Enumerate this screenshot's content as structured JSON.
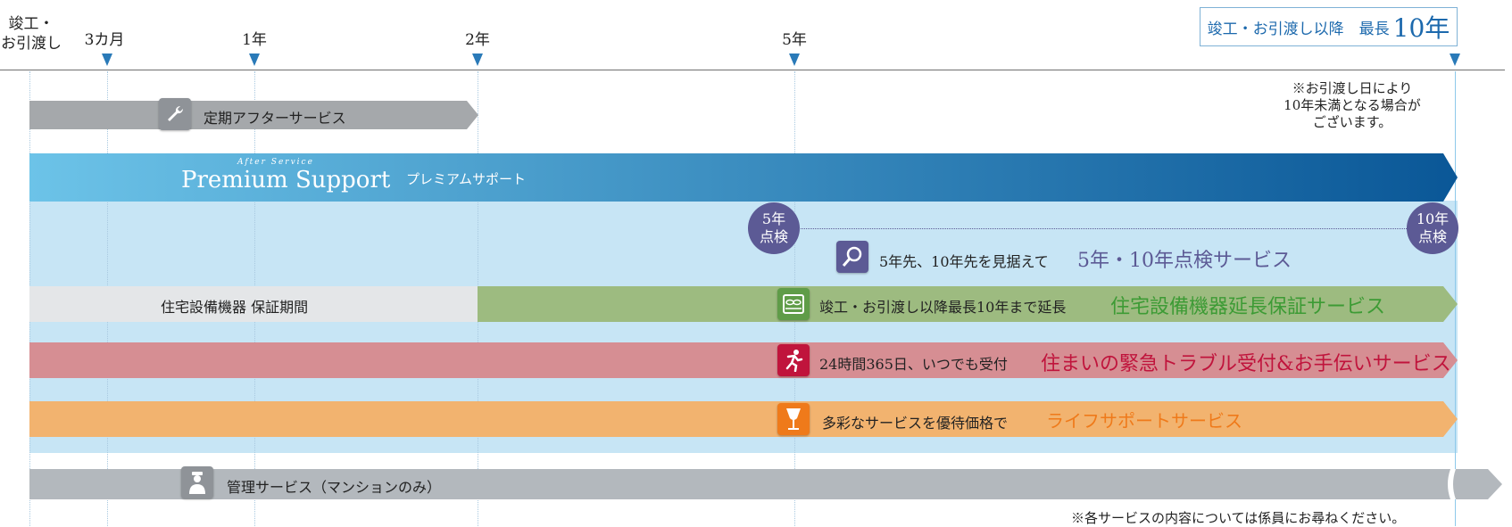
{
  "timeline": {
    "start_label_line1": "竣工・",
    "start_label_line2": "お引渡し",
    "ticks": [
      "3カ月",
      "1年",
      "2年",
      "5年"
    ]
  },
  "max_box": {
    "text": "竣工・お引渡し以降　最長",
    "value": "10年"
  },
  "note_max": [
    "※お引渡し日により",
    "10年未満となる場合が",
    "ございます。"
  ],
  "periodic": {
    "label": "定期アフターサービス",
    "icon": "wrench-icon",
    "color": "#a5a8ab"
  },
  "premium": {
    "small": "After Service",
    "logo": "Premium Support",
    "sub": "プレミアムサポート",
    "color_start": "#6cc3e8",
    "color_end": "#0a5797"
  },
  "inspection": {
    "circle_left_1": "5年",
    "circle_left_2": "点検",
    "circle_right_1": "10年",
    "circle_right_2": "点検",
    "desc": "5年先、10年先を見据えて",
    "name": "5年・10年点検サービス",
    "icon": "magnifier-icon",
    "color": "#5c5a95"
  },
  "equipment": {
    "warranty_label": "住宅設備機器 保証期間",
    "desc": "竣工・お引渡し以降最長10年まで延長",
    "name": "住宅設備機器延長保証サービス",
    "icon": "stove-icon",
    "color": "#9dbb80",
    "name_color": "#3d9b35"
  },
  "emergency": {
    "desc": "24時間365日、いつでも受付",
    "name": "住まいの緊急トラブル受付&お手伝いサービス",
    "icon": "running-person-icon",
    "color": "#d68e93",
    "name_color": "#c0143c"
  },
  "life": {
    "desc": "多彩なサービスを優待価格で",
    "name": "ライフサポートサービス",
    "icon": "glass-icon",
    "color": "#f2b36f",
    "name_color": "#ef7a1a"
  },
  "management": {
    "label": "管理サービス（マンションのみ）",
    "icon": "person-icon",
    "color": "#b3b8bd"
  },
  "footnote": "※各サービスの内容については係員にお尋ねください。"
}
